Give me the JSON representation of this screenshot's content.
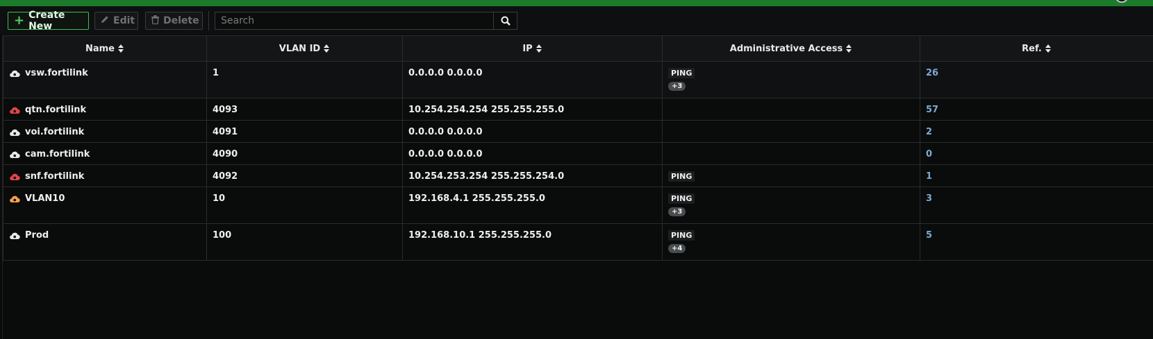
{
  "colors": {
    "top_strip": "#1c7a2b",
    "create_border": "#3fbf4f",
    "ref_link": "#7fa9d6",
    "cloud_white": "#e8e8e8",
    "cloud_red": "#e04545",
    "cloud_orange": "#f0a24a"
  },
  "toolbar": {
    "create_label": "Create New",
    "edit_label": "Edit",
    "delete_label": "Delete",
    "search_placeholder": "Search"
  },
  "table": {
    "headers": [
      "Name",
      "VLAN ID",
      "IP",
      "Administrative Access",
      "Ref."
    ],
    "rows": [
      {
        "name": "vsw.fortilink",
        "cloud": "cloud_white",
        "vlan": "1",
        "ip": "0.0.0.0 0.0.0.0",
        "access": "PING",
        "more": "+3",
        "ref": "26"
      },
      {
        "name": "qtn.fortilink",
        "cloud": "cloud_red",
        "vlan": "4093",
        "ip": "10.254.254.254 255.255.255.0",
        "access": "",
        "more": "",
        "ref": "57"
      },
      {
        "name": "voi.fortilink",
        "cloud": "cloud_white",
        "vlan": "4091",
        "ip": "0.0.0.0 0.0.0.0",
        "access": "",
        "more": "",
        "ref": "2"
      },
      {
        "name": "cam.fortilink",
        "cloud": "cloud_white",
        "vlan": "4090",
        "ip": "0.0.0.0 0.0.0.0",
        "access": "",
        "more": "",
        "ref": "0"
      },
      {
        "name": "snf.fortilink",
        "cloud": "cloud_red",
        "vlan": "4092",
        "ip": "10.254.253.254 255.255.254.0",
        "access": "PING",
        "more": "",
        "ref": "1"
      },
      {
        "name": "VLAN10",
        "cloud": "cloud_orange",
        "vlan": "10",
        "ip": "192.168.4.1 255.255.255.0",
        "access": "PING",
        "more": "+3",
        "ref": "3"
      },
      {
        "name": "Prod",
        "cloud": "cloud_white",
        "vlan": "100",
        "ip": "192.168.10.1 255.255.255.0",
        "access": "PING",
        "more": "+4",
        "ref": "5"
      }
    ]
  }
}
